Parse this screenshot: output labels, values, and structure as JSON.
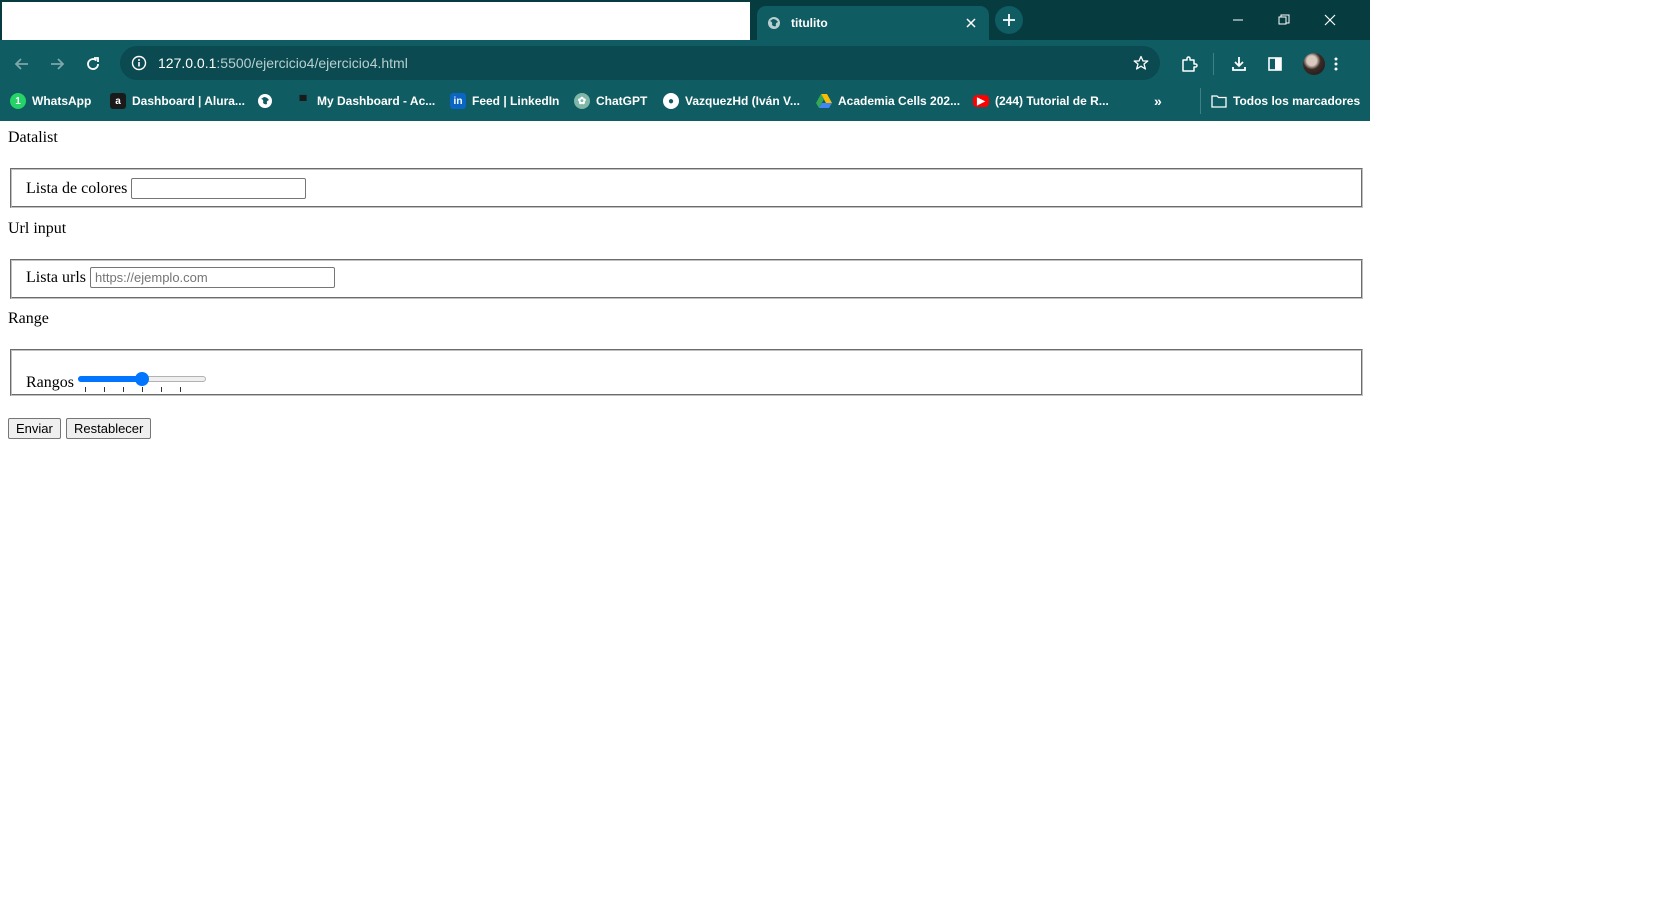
{
  "browser": {
    "tab_title": "titulito",
    "url_host": "127.0.0.1",
    "url_path": ":5500/ejercicio4/ejercicio4.html",
    "accent": "#0f5c63"
  },
  "bookmarks": {
    "items": [
      {
        "label": "WhatsApp",
        "icon": "whatsapp-icon"
      },
      {
        "label": "Dashboard | Alura...",
        "icon": "alura-icon"
      },
      {
        "label": "",
        "icon": "globe-icon"
      },
      {
        "label": "My Dashboard - Ac...",
        "icon": "dashboard-icon"
      },
      {
        "label": "Feed | LinkedIn",
        "icon": "linkedin-icon"
      },
      {
        "label": "ChatGPT",
        "icon": "chatgpt-icon"
      },
      {
        "label": "VazquezHd (Iván V...",
        "icon": "github-icon"
      },
      {
        "label": "Academia Cells 202...",
        "icon": "google-drive-icon"
      },
      {
        "label": "(244) Tutorial de R...",
        "icon": "youtube-icon"
      }
    ],
    "overflow": "»",
    "all_bookmarks": "Todos los marcadores"
  },
  "page": {
    "datalist": {
      "heading": "Datalist",
      "label": "Lista de colores",
      "value": ""
    },
    "url_input": {
      "heading": "Url input",
      "label": "Lista urls",
      "placeholder": "https://ejemplo.com"
    },
    "range": {
      "heading": "Range",
      "label": "Rangos",
      "value_fraction": 0.5
    },
    "buttons": {
      "submit": "Enviar",
      "reset": "Restablecer"
    }
  }
}
